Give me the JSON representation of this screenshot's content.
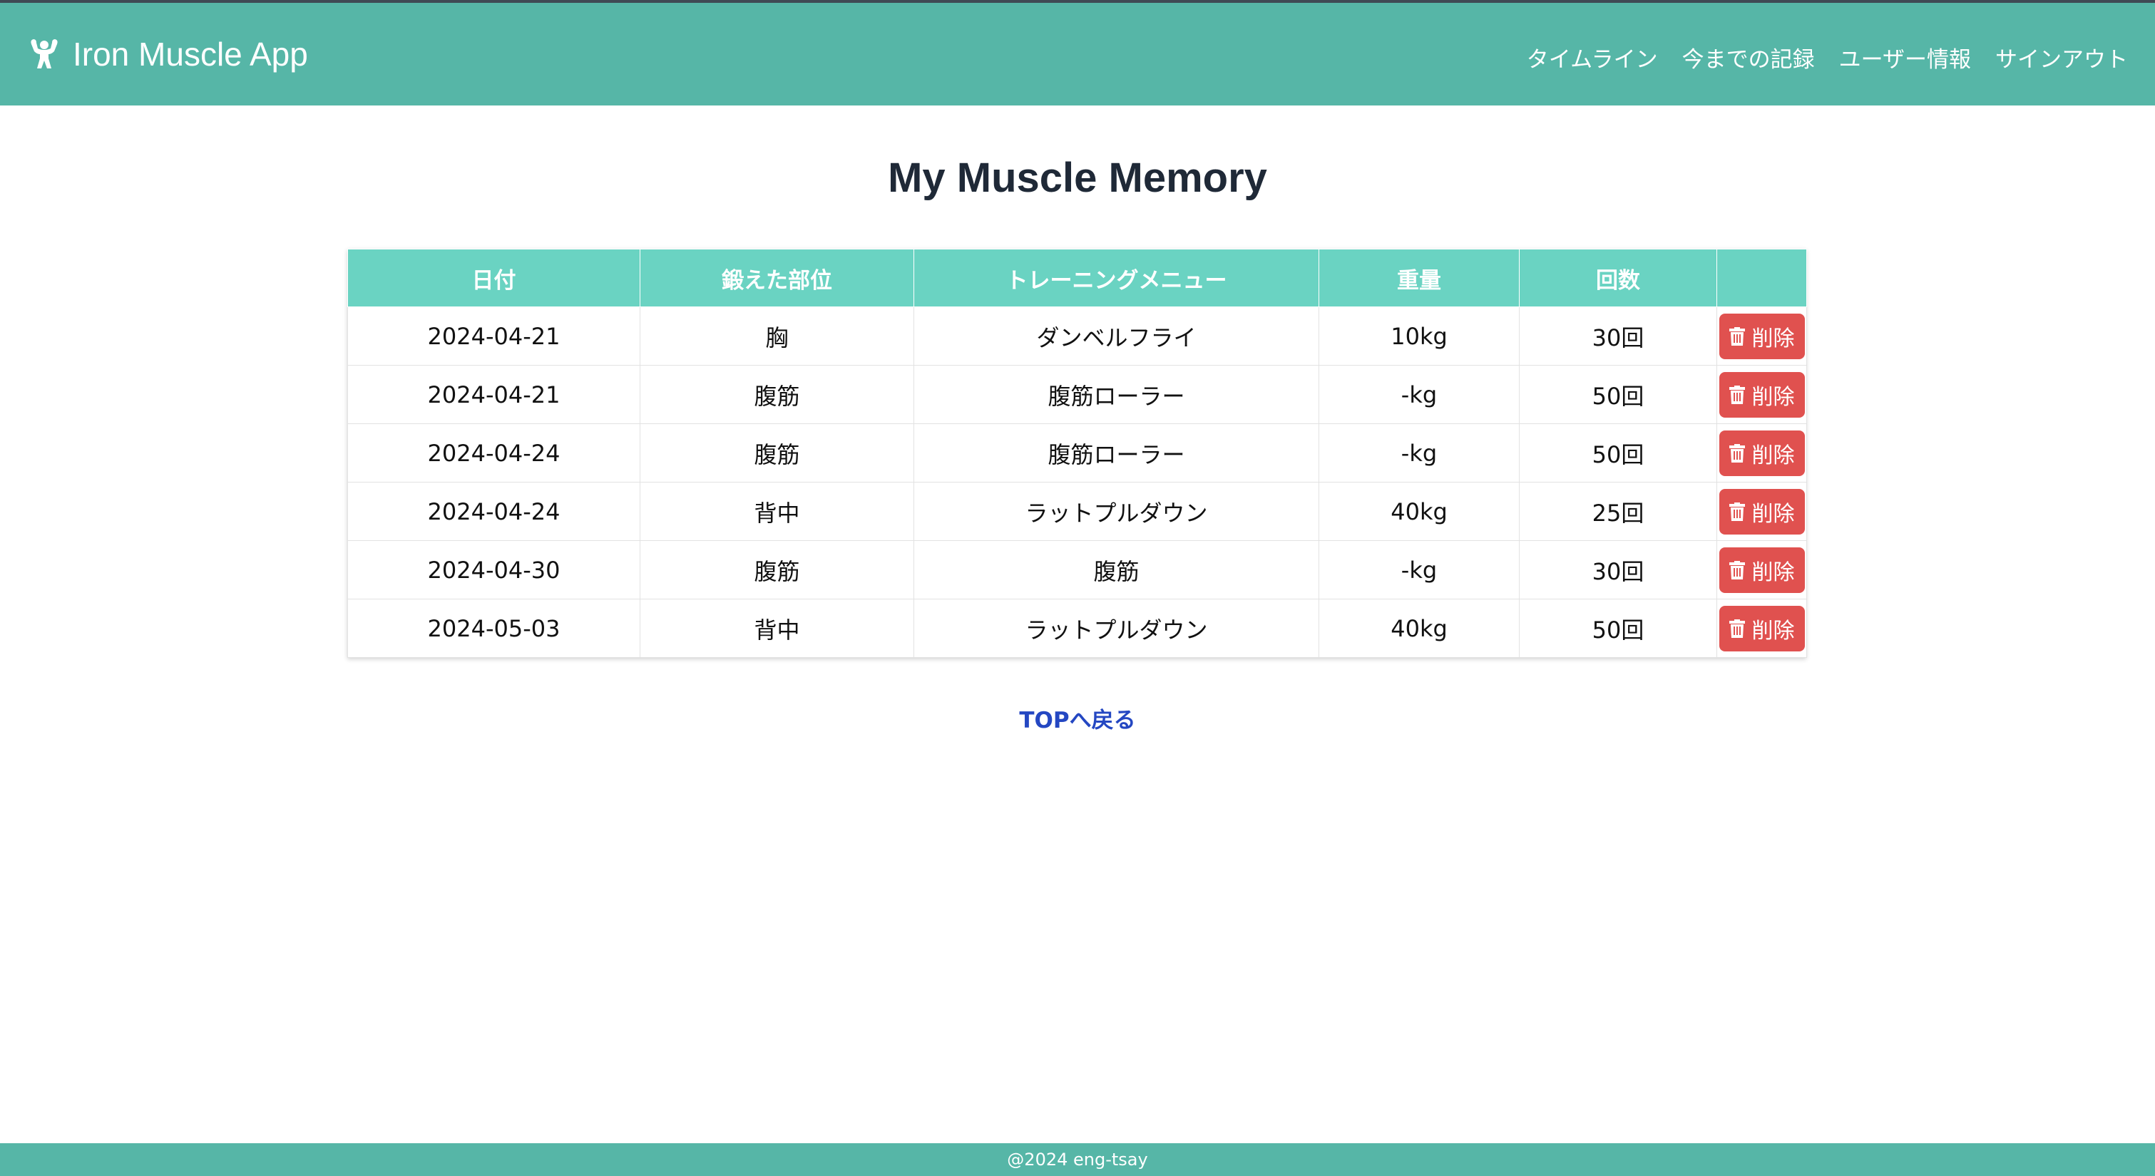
{
  "navbar": {
    "brand_icon": "muscle-icon",
    "brand_name": "Iron Muscle App",
    "links": [
      "タイムライン",
      "今までの記録",
      "ユーザー情報",
      "サインアウト"
    ]
  },
  "page_title": "My Muscle Memory",
  "table": {
    "headers": [
      "日付",
      "鍛えた部位",
      "トレーニングメニュー",
      "重量",
      "回数",
      ""
    ],
    "rows": [
      {
        "date": "2024-04-21",
        "part": "胸",
        "menu": "ダンベルフライ",
        "weight": "10kg",
        "reps": "30回",
        "action": "削除"
      },
      {
        "date": "2024-04-21",
        "part": "腹筋",
        "menu": "腹筋ローラー",
        "weight": "-kg",
        "reps": "50回",
        "action": "削除"
      },
      {
        "date": "2024-04-24",
        "part": "腹筋",
        "menu": "腹筋ローラー",
        "weight": "-kg",
        "reps": "50回",
        "action": "削除"
      },
      {
        "date": "2024-04-24",
        "part": "背中",
        "menu": "ラットプルダウン",
        "weight": "40kg",
        "reps": "25回",
        "action": "削除"
      },
      {
        "date": "2024-04-30",
        "part": "腹筋",
        "menu": "腹筋",
        "weight": "-kg",
        "reps": "30回",
        "action": "削除"
      },
      {
        "date": "2024-05-03",
        "part": "背中",
        "menu": "ラットプルダウン",
        "weight": "40kg",
        "reps": "50回",
        "action": "削除"
      }
    ],
    "delete_icon": "trash-icon"
  },
  "back_link": "TOPへ戻る",
  "footer": "@2024 eng-tsay",
  "colors": {
    "navbar": "#56b6a7",
    "table_header": "#6ad3c2",
    "delete_button": "#e0514f",
    "link": "#2447c2"
  }
}
